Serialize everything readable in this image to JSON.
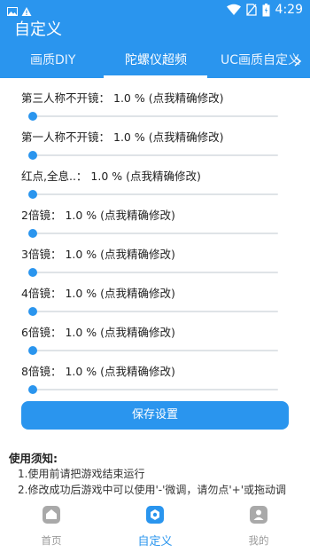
{
  "status_bar": {
    "time": "4:29",
    "icons": [
      "image-icon",
      "alert-icon",
      "wifi-icon",
      "no-sim-icon",
      "battery-icon"
    ]
  },
  "app_bar": {
    "title": "自定义"
  },
  "tabs": [
    {
      "label": "画质DIY",
      "active": false
    },
    {
      "label": "陀螺仪超频",
      "active": true
    },
    {
      "label": "UC画质自定义",
      "active": false
    }
  ],
  "settings": [
    {
      "label": "第三人称不开镜：",
      "value": "1.0 %",
      "hint": "(点我精确修改)",
      "level": 0.01
    },
    {
      "label": "第一人称不开镜：",
      "value": "1.0 %",
      "hint": "(点我精确修改)",
      "level": 0.01
    },
    {
      "label": "红点,全息..：",
      "value": "1.0 %",
      "hint": "(点我精确修改)",
      "level": 0.01
    },
    {
      "label": "2倍镜：",
      "value": "1.0 %",
      "hint": "(点我精确修改)",
      "level": 0.01
    },
    {
      "label": "3倍镜：",
      "value": "1.0 %",
      "hint": "(点我精确修改)",
      "level": 0.01
    },
    {
      "label": "4倍镜：",
      "value": "1.0 %",
      "hint": "(点我精确修改)",
      "level": 0.01
    },
    {
      "label": "6倍镜：",
      "value": "1.0 %",
      "hint": "(点我精确修改)",
      "level": 0.01
    },
    {
      "label": "8倍镜：",
      "value": "1.0 %",
      "hint": "(点我精确修改)",
      "level": 0.01
    }
  ],
  "save_button": "保存设置",
  "notice": {
    "title": "使用须知:",
    "items": [
      "1.使用前请把游戏结束运行",
      "2.修改成功后游戏中可以使用'-'微调，请勿点'+'或拖动调"
    ]
  },
  "bottom_nav": [
    {
      "label": "首页",
      "icon": "home-icon",
      "active": false
    },
    {
      "label": "自定义",
      "icon": "custom-icon",
      "active": true
    },
    {
      "label": "我的",
      "icon": "profile-icon",
      "active": false
    }
  ],
  "colors": {
    "primary": "#2a95ee",
    "track": "#dfe3e7",
    "muted": "#9a9a9a"
  }
}
